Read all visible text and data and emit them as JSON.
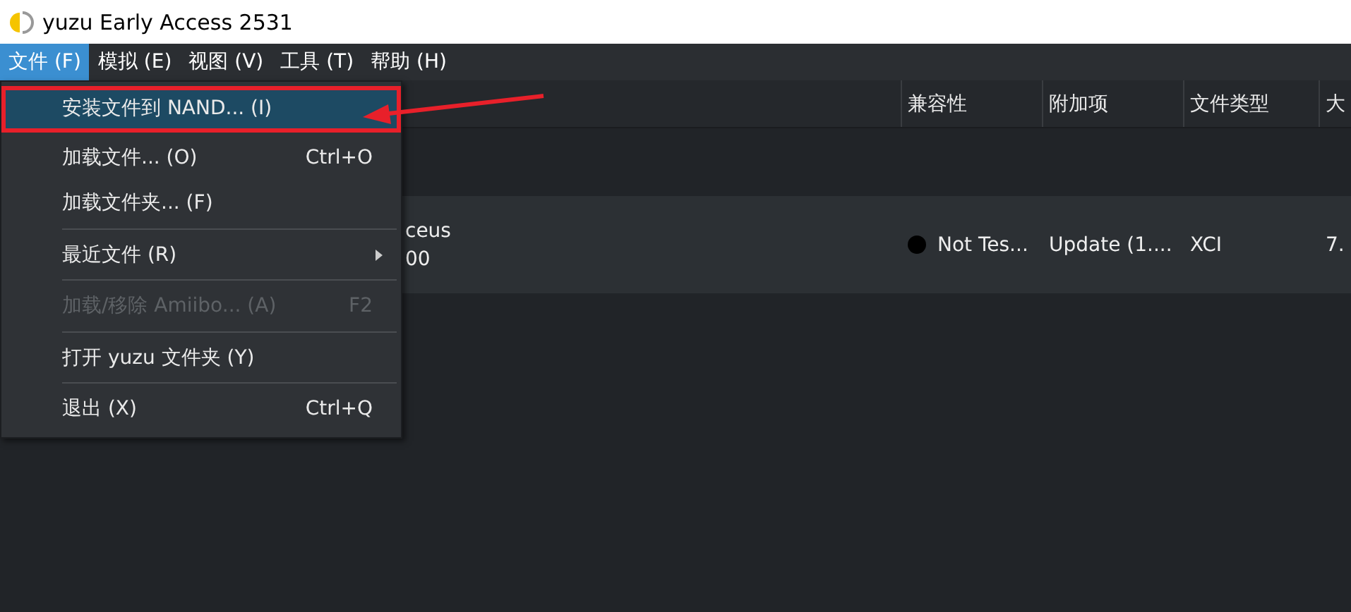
{
  "window": {
    "title": "yuzu Early Access 2531"
  },
  "menubar": [
    {
      "label": "文件 (F)",
      "selected": true
    },
    {
      "label": "模拟 (E)",
      "selected": false
    },
    {
      "label": "视图 (V)",
      "selected": false
    },
    {
      "label": "工具 (T)",
      "selected": false
    },
    {
      "label": "帮助 (H)",
      "selected": false
    }
  ],
  "table": {
    "columns": [
      "兼容性",
      "附加项",
      "文件类型",
      "大"
    ],
    "rows": [
      {
        "name_lines": [
          "ceus",
          "00"
        ],
        "compatibility": "Not Tes...",
        "color": "#000000",
        "addons": "Update (1....",
        "file_type": "XCI",
        "size": "7."
      }
    ]
  },
  "file_menu": [
    {
      "kind": "item",
      "label": "安装文件到 NAND... (I)",
      "selected": true,
      "disabled": false,
      "annotated": true
    },
    {
      "kind": "item",
      "label": "加载文件... (O)",
      "shortcut": "Ctrl+O",
      "selected": false,
      "disabled": false
    },
    {
      "kind": "item",
      "label": "加载文件夹... (F)",
      "selected": false,
      "disabled": false
    },
    {
      "kind": "separator"
    },
    {
      "kind": "submenu",
      "label": "最近文件 (R)",
      "selected": false,
      "disabled": false
    },
    {
      "kind": "separator"
    },
    {
      "kind": "item",
      "label": "加载/移除 Amiibo... (A)",
      "shortcut": "F2",
      "selected": false,
      "disabled": true
    },
    {
      "kind": "separator"
    },
    {
      "kind": "item",
      "label": "打开 yuzu 文件夹 (Y)",
      "selected": false,
      "disabled": false
    },
    {
      "kind": "separator"
    },
    {
      "kind": "item",
      "label": "退出 (X)",
      "shortcut": "Ctrl+Q",
      "selected": false,
      "disabled": false
    }
  ]
}
